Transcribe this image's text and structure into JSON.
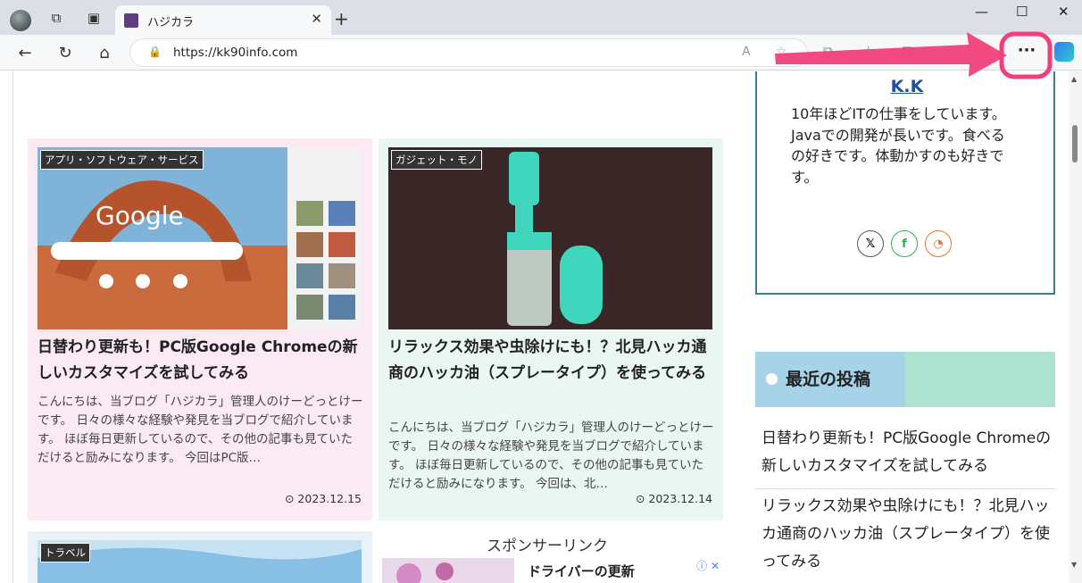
{
  "browser": {
    "tab_title": "ハジカラ",
    "url": "https://kk90info.com"
  },
  "icons": {
    "back": "back-arrow-icon",
    "refresh": "refresh-icon",
    "home": "home-icon",
    "more": "more-menu-icon"
  },
  "colors": {
    "annotation": "#f0407a",
    "card1_bg": "#fbe9f4",
    "card2_bg": "#eaf6f2",
    "accent": "#3d7e8e"
  },
  "cards": [
    {
      "category": "アプリ・ソフトウェア・サービス",
      "title": "日替わり更新も！PC版Google Chromeの新しいカスタマイズを試してみる",
      "excerpt": "こんにちは、当ブログ「ハジカラ」管理人のけーどっとけーです。 日々の様々な経験や発見を当ブログで紹介しています。 ほぼ毎日更新しているので、その他の記事も見ていただけると励みになります。 今回はPC版…",
      "date": "2023.12.15"
    },
    {
      "category": "ガジェット・モノ",
      "title": "リラックス効果や虫除けにも！？北見ハッカ通商のハッカ油（スプレータイプ）を使ってみる",
      "excerpt": "こんにちは、当ブログ「ハジカラ」管理人のけーどっとけーです。 日々の様々な経験や発見を当ブログで紹介しています。 ほぼ毎日更新しているので、その他の記事も見ていただけると励みになります。 今回は、北…",
      "date": "2023.12.14"
    },
    {
      "category": "トラベル"
    }
  ],
  "sponsor": {
    "label": "スポンサーリンク",
    "ad_title": "ドライバーの更新"
  },
  "profile": {
    "name": "K.K",
    "bio": "10年ほどITの仕事をしています。Javaでの開発が長いです。食べるの好きです。体動かすのも好きです。"
  },
  "recent": {
    "heading": "最近の投稿",
    "items": [
      "日替わり更新も！PC版Google Chromeの新しいカスタマイズを試してみる",
      "リラックス効果や虫除けにも！？北見ハッカ通商のハッカ油（スプレータイプ）を使ってみる"
    ]
  }
}
